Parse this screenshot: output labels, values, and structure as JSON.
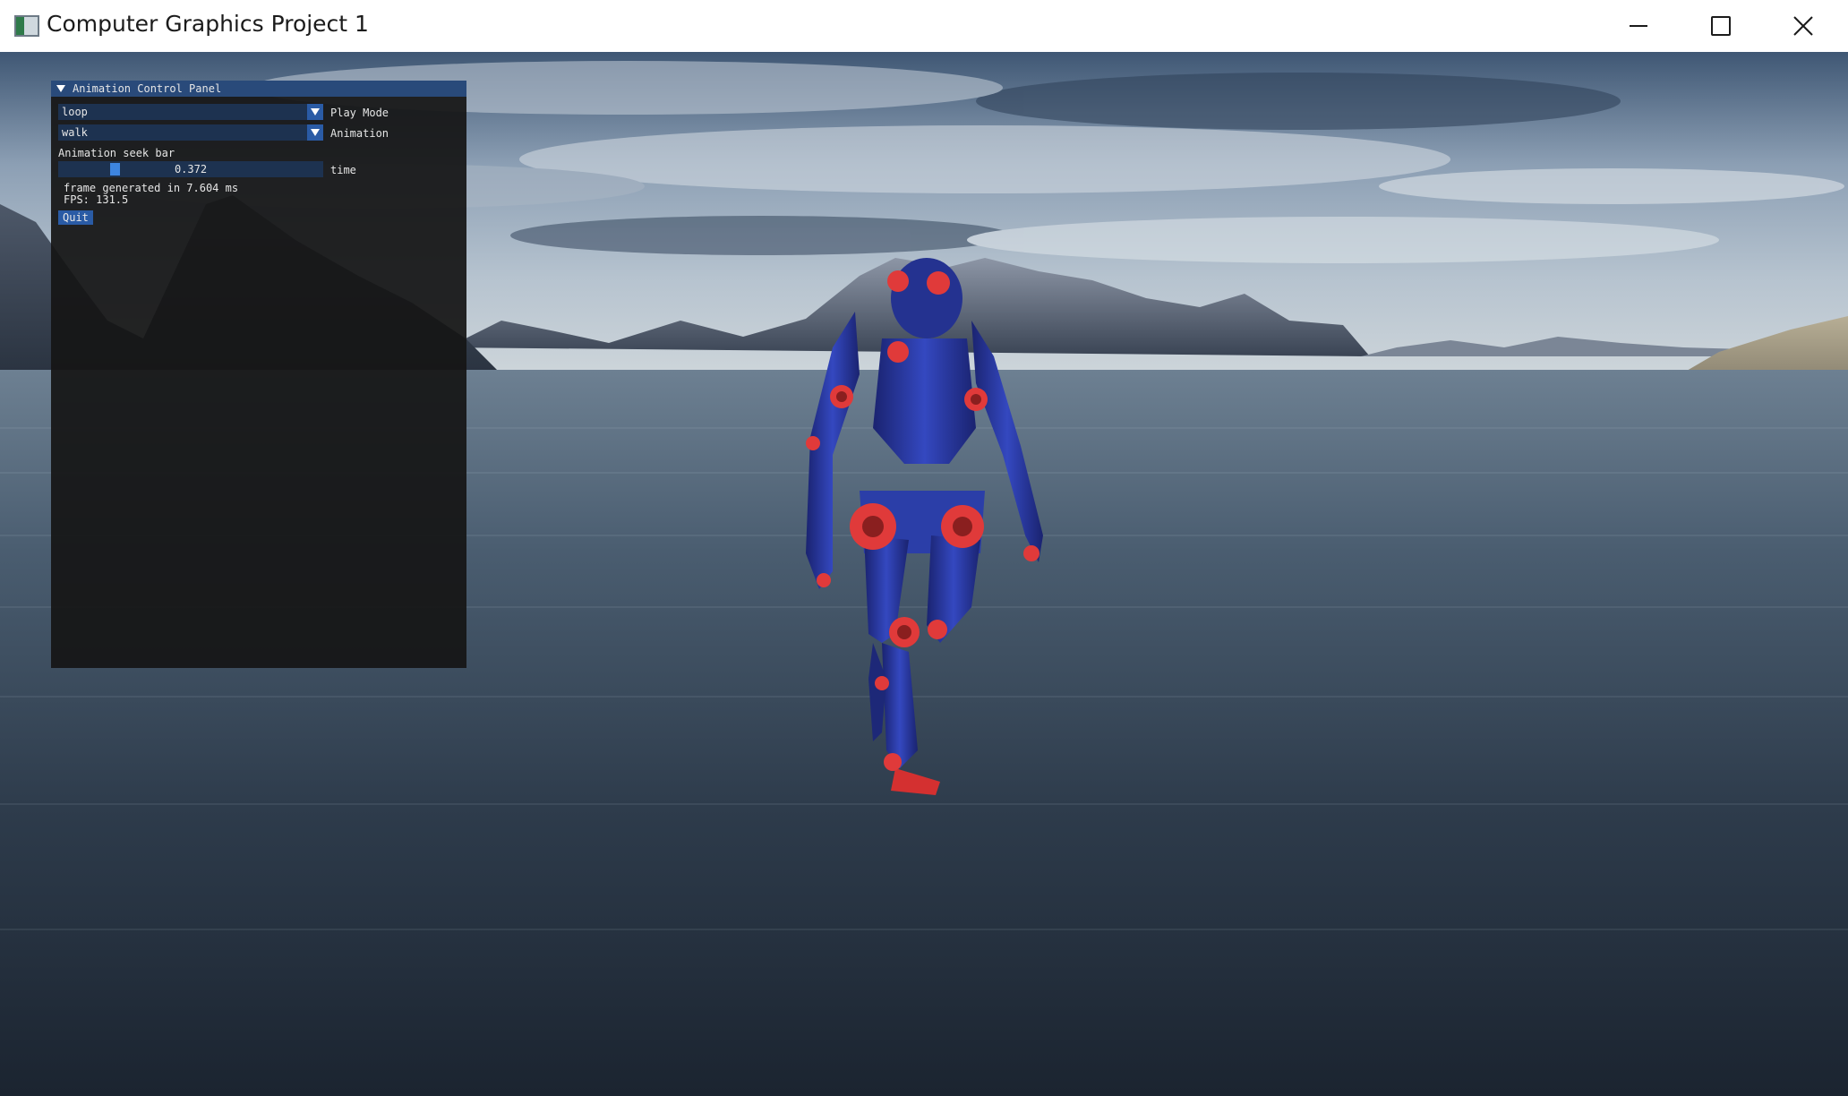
{
  "window": {
    "title": "Computer Graphics Project 1",
    "controls": [
      "minimize-icon",
      "maximize-icon",
      "close-icon"
    ]
  },
  "panel": {
    "title": "Animation Control Panel",
    "play_mode": {
      "value": "loop",
      "label": "Play Mode"
    },
    "animation": {
      "value": "walk",
      "label": "Animation"
    },
    "seek_bar": {
      "caption": "Animation seek bar",
      "value": "0.372",
      "label": "time",
      "fraction": 0.2
    },
    "stats": {
      "frame_time": "frame generated in 7.604 ms",
      "fps": "FPS: 131.5"
    },
    "quit_label": "Quit"
  },
  "colors": {
    "panel_header": "#294a7a",
    "widget_bg": "#1d3250",
    "accent": "#2a5ba5",
    "robot_body": "#2b3ea8",
    "robot_joint": "#e03a3a"
  }
}
